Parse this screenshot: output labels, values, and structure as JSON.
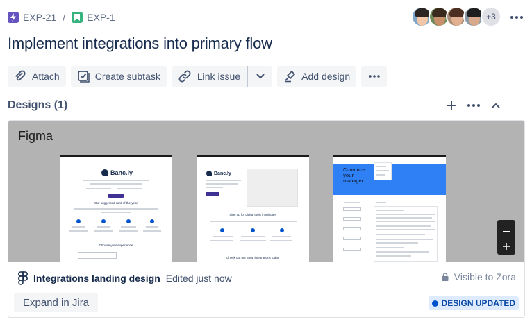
{
  "breadcrumb": {
    "parent": {
      "key": "EXP-21",
      "icon": "lightning-icon",
      "color": "#6554c0"
    },
    "separator": "/",
    "current": {
      "key": "EXP-1",
      "icon": "bookmark-icon",
      "color": "#36b37e"
    }
  },
  "watchers": {
    "more_label": "+3"
  },
  "issue": {
    "title": "Implement integrations into primary flow"
  },
  "toolbar": {
    "attach": "Attach",
    "create_subtask": "Create subtask",
    "link_issue": "Link issue",
    "add_design": "Add design"
  },
  "designs": {
    "heading": "Designs (1)",
    "card": {
      "source_label": "Figma",
      "file_name": "Integrations landing design",
      "edited": "Edited just now",
      "visibility": "Visible to Zora",
      "expand_label": "Expand in Jira",
      "status": "DESIGN UPDATED",
      "status_color": "#0052cc",
      "frames": [
        {
          "brand": "Banc.ly",
          "heading": "Our suggested card of the year",
          "footer_text": "Choose your experience"
        },
        {
          "brand": "Banc.ly",
          "heading": "Sign up for digital tools in minutes",
          "footer_text": "Check out our 3 top integrations today"
        },
        {
          "heading_line1": "Convince",
          "heading_line2": "your",
          "heading_line3": "manager"
        }
      ]
    }
  },
  "colors": {
    "accent": "#0052cc",
    "text": "#172b4d",
    "subtle": "#42526e"
  }
}
